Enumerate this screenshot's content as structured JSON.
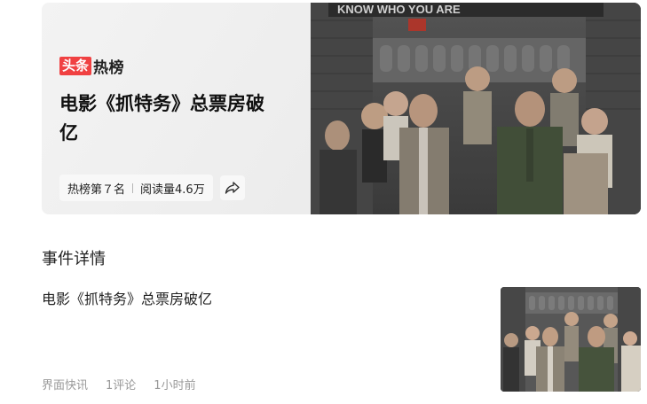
{
  "hero": {
    "brand_box": "头条",
    "brand_text": "热榜",
    "headline": "电影《抓特务》总票房破亿",
    "rank": "热榜第７名",
    "reads": "阅读量4.6万",
    "share_icon": "share-arrow-icon",
    "sign_text": "KNOW WHO YOU ARE"
  },
  "section": {
    "title": "事件详情"
  },
  "news": {
    "title": "电影《抓特务》总票房破亿",
    "source": "界面快讯",
    "comments": "1评论",
    "time": "1小时前"
  },
  "colors": {
    "brand_red": "#f04142",
    "meta_gray": "#999999"
  }
}
